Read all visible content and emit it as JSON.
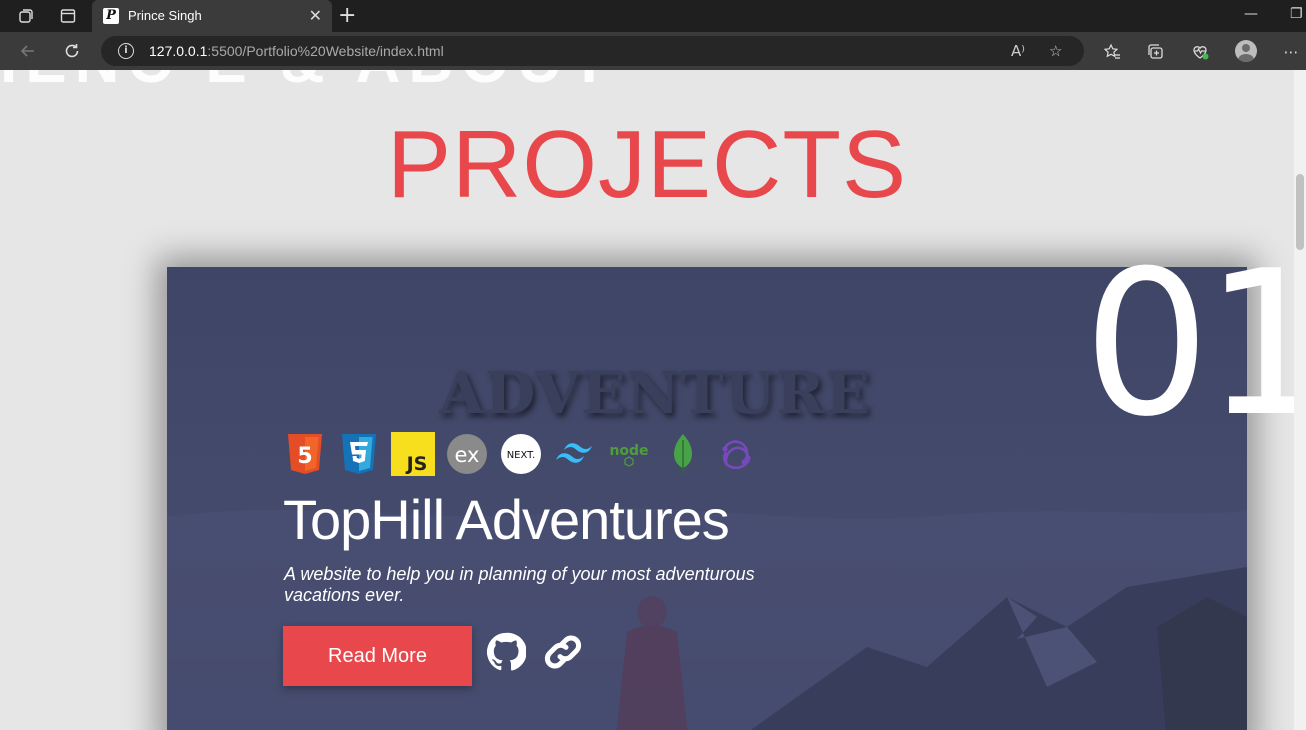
{
  "browser": {
    "tab_title": "Prince Singh",
    "tab_favicon_letter": "P",
    "url_host": "127.0.0.1",
    "url_path": ":5500/Portfolio%20Website/index.html",
    "read_aloud_label": "A⁾"
  },
  "page": {
    "section_title": "PROJECTS",
    "ghost_heading": "IENC E   & ABOUT"
  },
  "project": {
    "number": "01",
    "watermark": "ADVENTURE",
    "title": "TopHill Adventures",
    "description": "A website to help you in planning of your most adventurous vacations ever.",
    "read_more_label": "Read More",
    "tech": {
      "html_label": "5",
      "js_label": "JS",
      "express_label": "ex",
      "next_label": "NEXT.",
      "node_label": "node"
    }
  },
  "colors": {
    "accent": "#e8484c",
    "card_bg": "#414868",
    "page_bg": "#e6e6e6"
  }
}
